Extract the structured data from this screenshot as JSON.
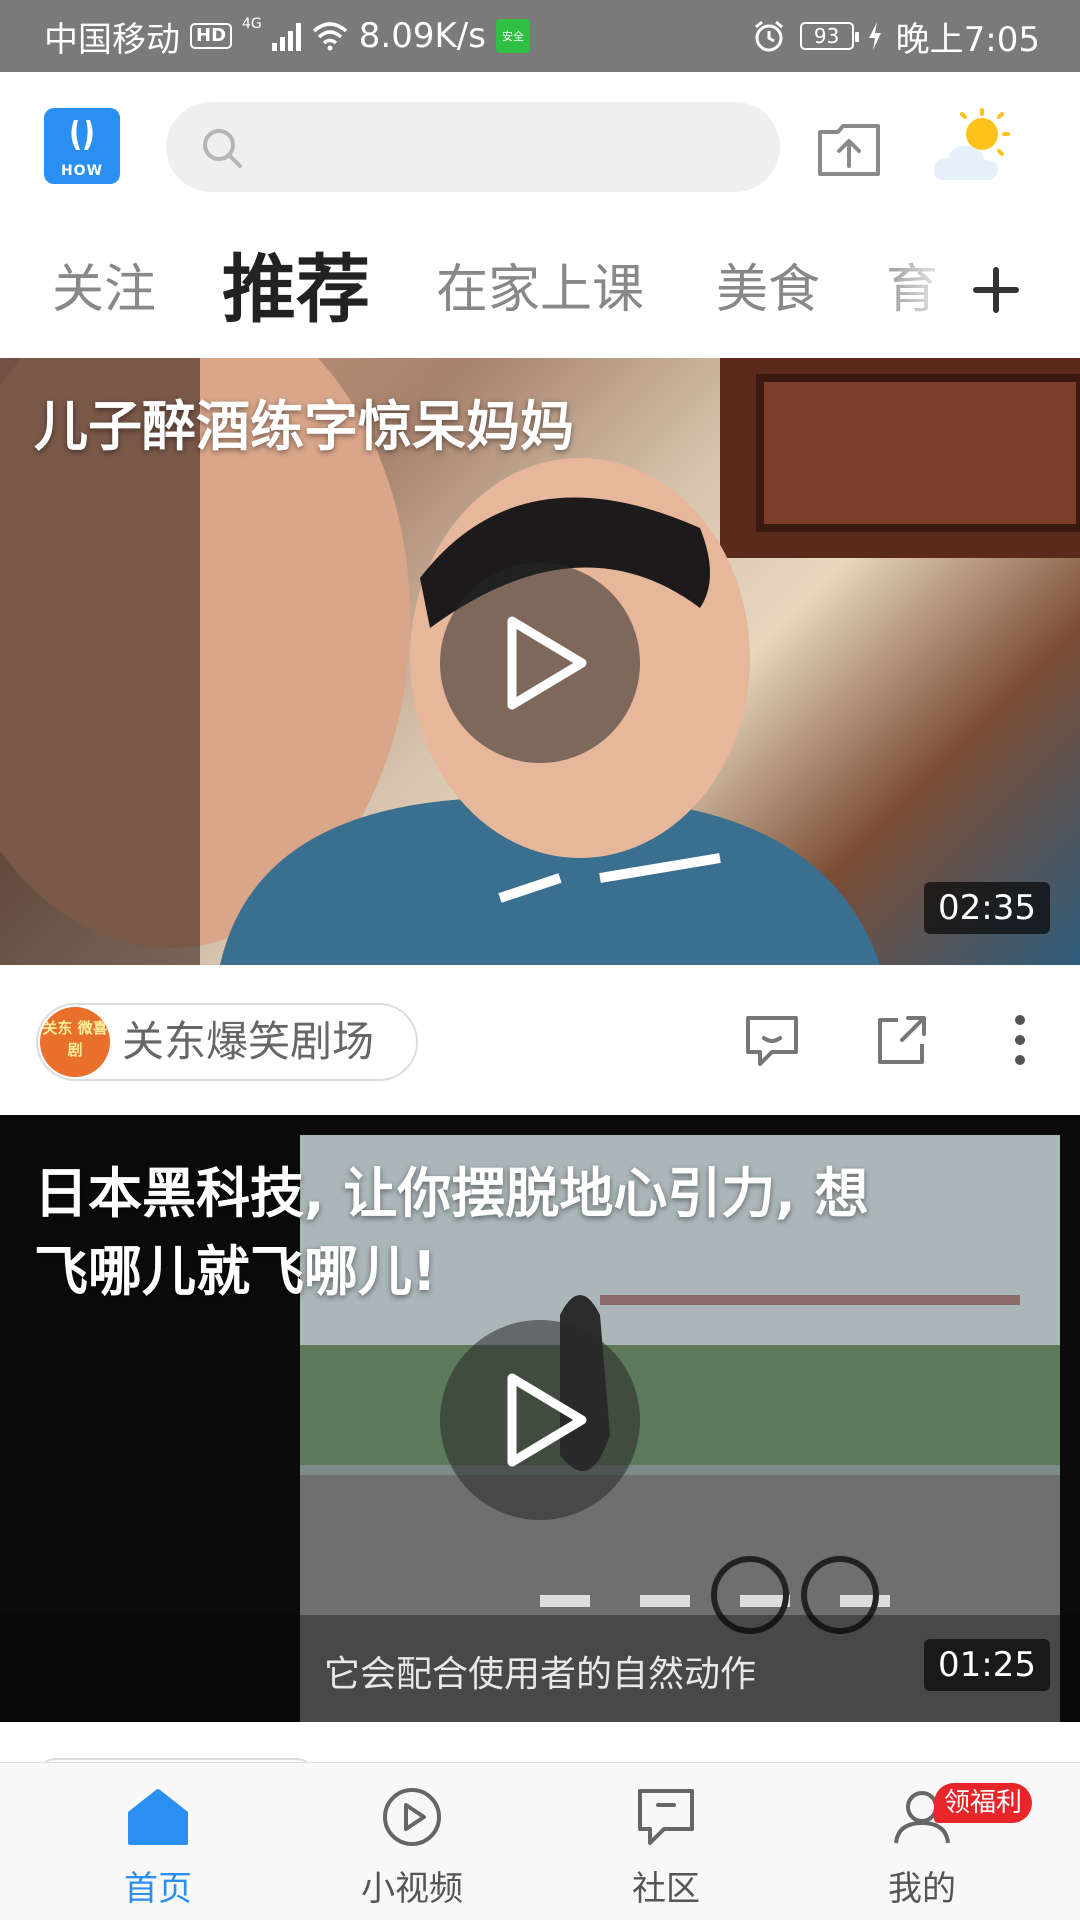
{
  "status_bar": {
    "carrier": "中国移动",
    "hd": "HD",
    "network": "4G",
    "speed": "8.09K/s",
    "app_badge": "安全",
    "battery": "93",
    "time": "晚上7:05"
  },
  "header": {
    "logo_text": "HOW",
    "search_placeholder": ""
  },
  "tabs": [
    {
      "label": "关注",
      "active": false
    },
    {
      "label": "推荐",
      "active": true
    },
    {
      "label": "在家上课",
      "active": false
    },
    {
      "label": "美食",
      "active": false
    },
    {
      "label": "育",
      "active": false
    }
  ],
  "feed": [
    {
      "title": "儿子醉酒练字惊呆妈妈",
      "duration": "02:35",
      "author": "关东爆笑剧场",
      "author_avatar_text": "关东 微喜剧"
    },
    {
      "title_line1": "日本黑科技, 让你摆脱地心引力, 想",
      "title_line2": "飞哪儿就飞哪儿!",
      "subtitle": "它会配合使用者的自然动作",
      "duration": "01:25"
    }
  ],
  "bottom_nav": [
    {
      "label": "首页",
      "icon": "home-icon",
      "active": true
    },
    {
      "label": "小视频",
      "icon": "play-circle-icon",
      "active": false
    },
    {
      "label": "社区",
      "icon": "community-icon",
      "active": false
    },
    {
      "label": "我的",
      "icon": "user-icon",
      "active": false
    }
  ],
  "promo_badge": "领福利",
  "colors": {
    "accent": "#2a8ff0",
    "badge": "#e8262a",
    "status_bar": "#7a7a7a"
  }
}
